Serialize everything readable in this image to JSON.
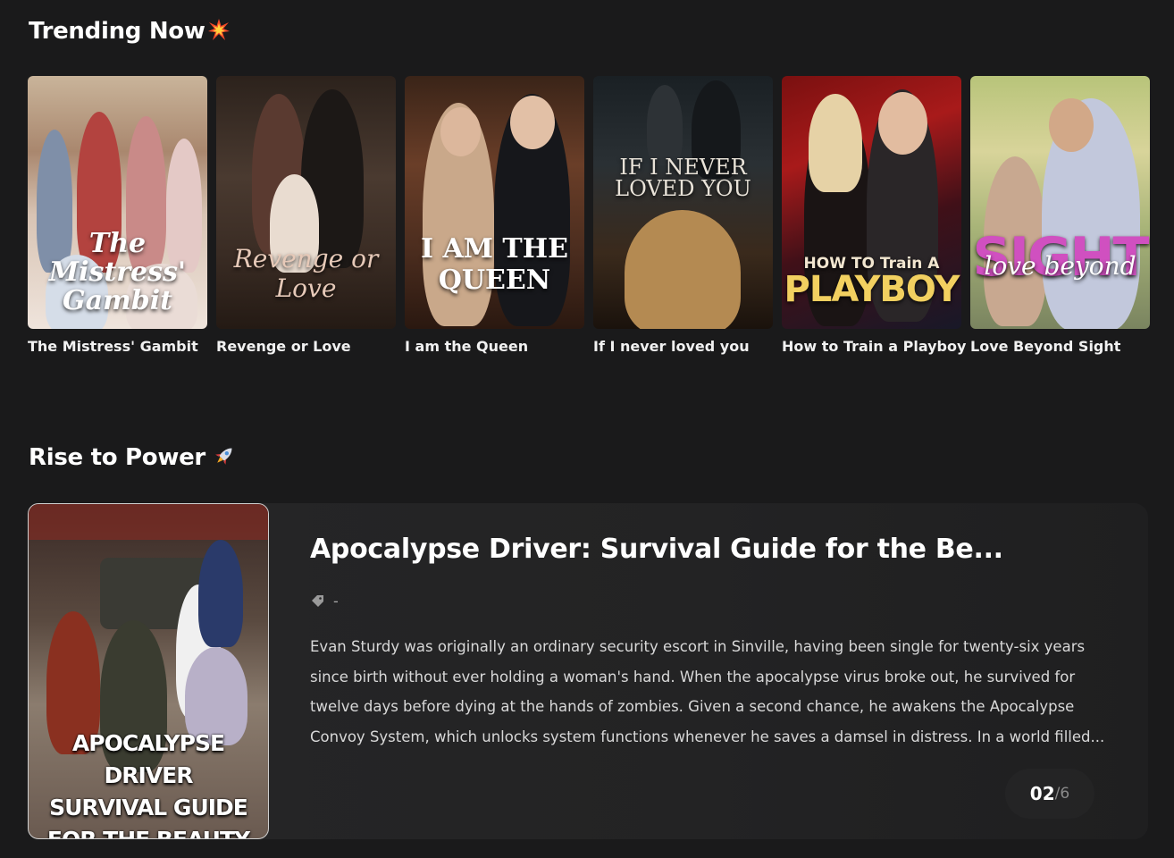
{
  "trending": {
    "title": "Trending Now",
    "emoji": "collision-emoji",
    "items": [
      {
        "title": "The Mistress' Gambit",
        "cover_text": "The Mistress' Gambit"
      },
      {
        "title": "Revenge or Love",
        "cover_text": "Revenge or Love"
      },
      {
        "title": "I am the Queen",
        "cover_text": "I AM THE QUEEN"
      },
      {
        "title": "If I never loved you",
        "cover_text": "IF I NEVER LOVED YOU"
      },
      {
        "title": "How to Train a Playboy",
        "cover_text_top": "HOW TO Train A",
        "cover_text_bottom": "PLAYBOY"
      },
      {
        "title": "Love Beyond Sight",
        "cover_text_big": "SIGHT",
        "cover_text_script": "love beyond"
      }
    ]
  },
  "rise": {
    "title": "Rise to Power",
    "emoji": "rocket-emoji",
    "banner": {
      "title": "Apocalypse Driver: Survival Guide for the Be...",
      "tag": "-",
      "description": "Evan Sturdy was originally an ordinary security escort in Sinville, having been single for twenty-six years since birth without ever holding a woman's hand. When the apocalypse virus broke out, he survived for twelve days before dying at the hands of zombies. Given a second chance, he awakens the Apocalypse Convoy System, which unlocks system functions whenever he saves a damsel in distress. In a world filled...",
      "cover_lines": [
        "APOCALYPSE DRIVER",
        "SURVIVAL GUIDE",
        "FOR THE BEAUTY"
      ],
      "counter_current": "02",
      "counter_total": "/6"
    }
  }
}
